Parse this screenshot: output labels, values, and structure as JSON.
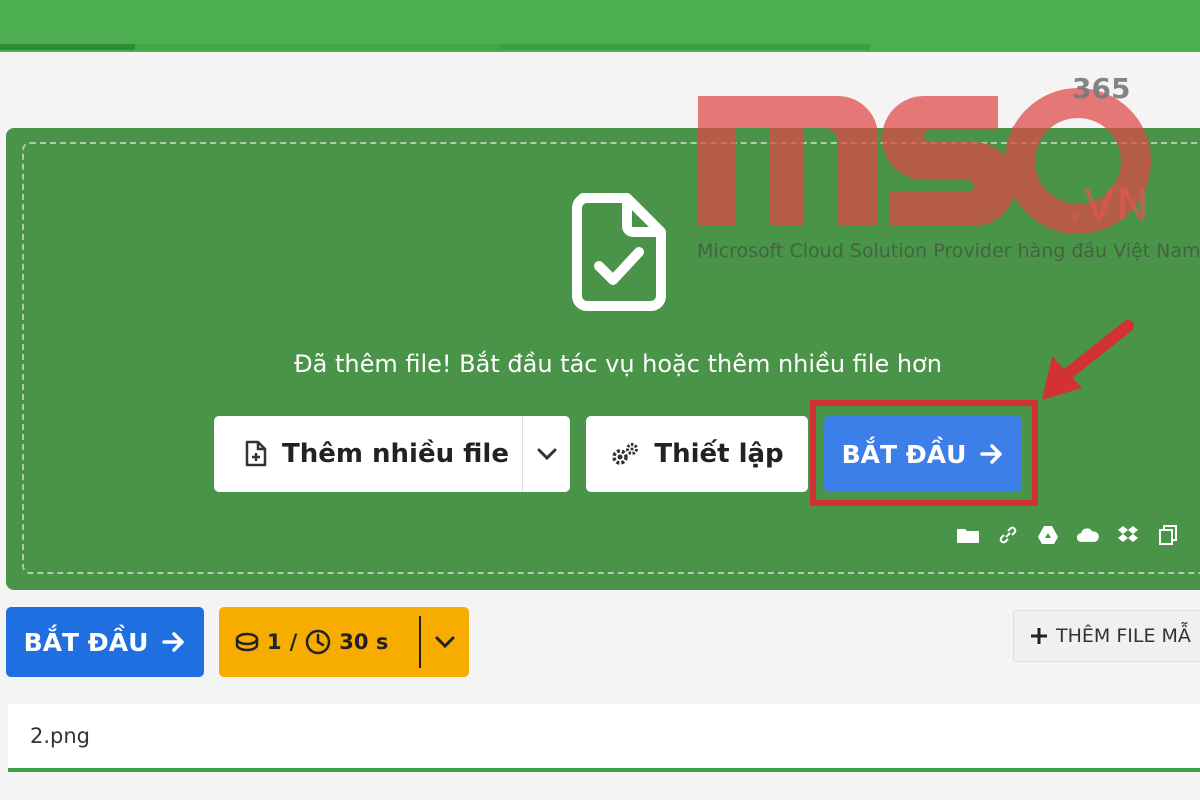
{
  "toolbar_progress": {
    "colors": [
      "#2f8a36",
      "#43a548",
      "#3f9d45"
    ]
  },
  "drop_zone": {
    "status_text": "Đã thêm file! Bắt đầu tác vụ hoặc thêm nhiều file hơn",
    "add_files_label": "Thêm nhiều file",
    "settings_label": "Thiết lập",
    "start_label": "BẮT ĐẦU",
    "source_icons": [
      "folder-icon",
      "link-icon",
      "google-drive-icon",
      "onedrive-icon",
      "dropbox-icon",
      "clipboard-icon"
    ]
  },
  "action_bar": {
    "start_label": "BẮT ĐẦU",
    "credits_count": "1",
    "credits_sep": "/",
    "time_value": "30 s",
    "add_sample_label": "THÊM FILE MẪ"
  },
  "file_list": [
    {
      "name": "2.png"
    }
  ],
  "watermark": {
    "brand": "MSO",
    "suffix": ".VN",
    "superscript": "365",
    "tagline": "Microsoft Cloud Solution Provider hàng đầu Việt Nam"
  },
  "colors": {
    "header_green": "#4cae4f",
    "panel_green": "#4a9449",
    "start_blue": "#3d7fe8",
    "bottom_start_blue": "#1f6fe0",
    "credits_orange": "#f7ad00",
    "highlight_red": "#d23232"
  }
}
